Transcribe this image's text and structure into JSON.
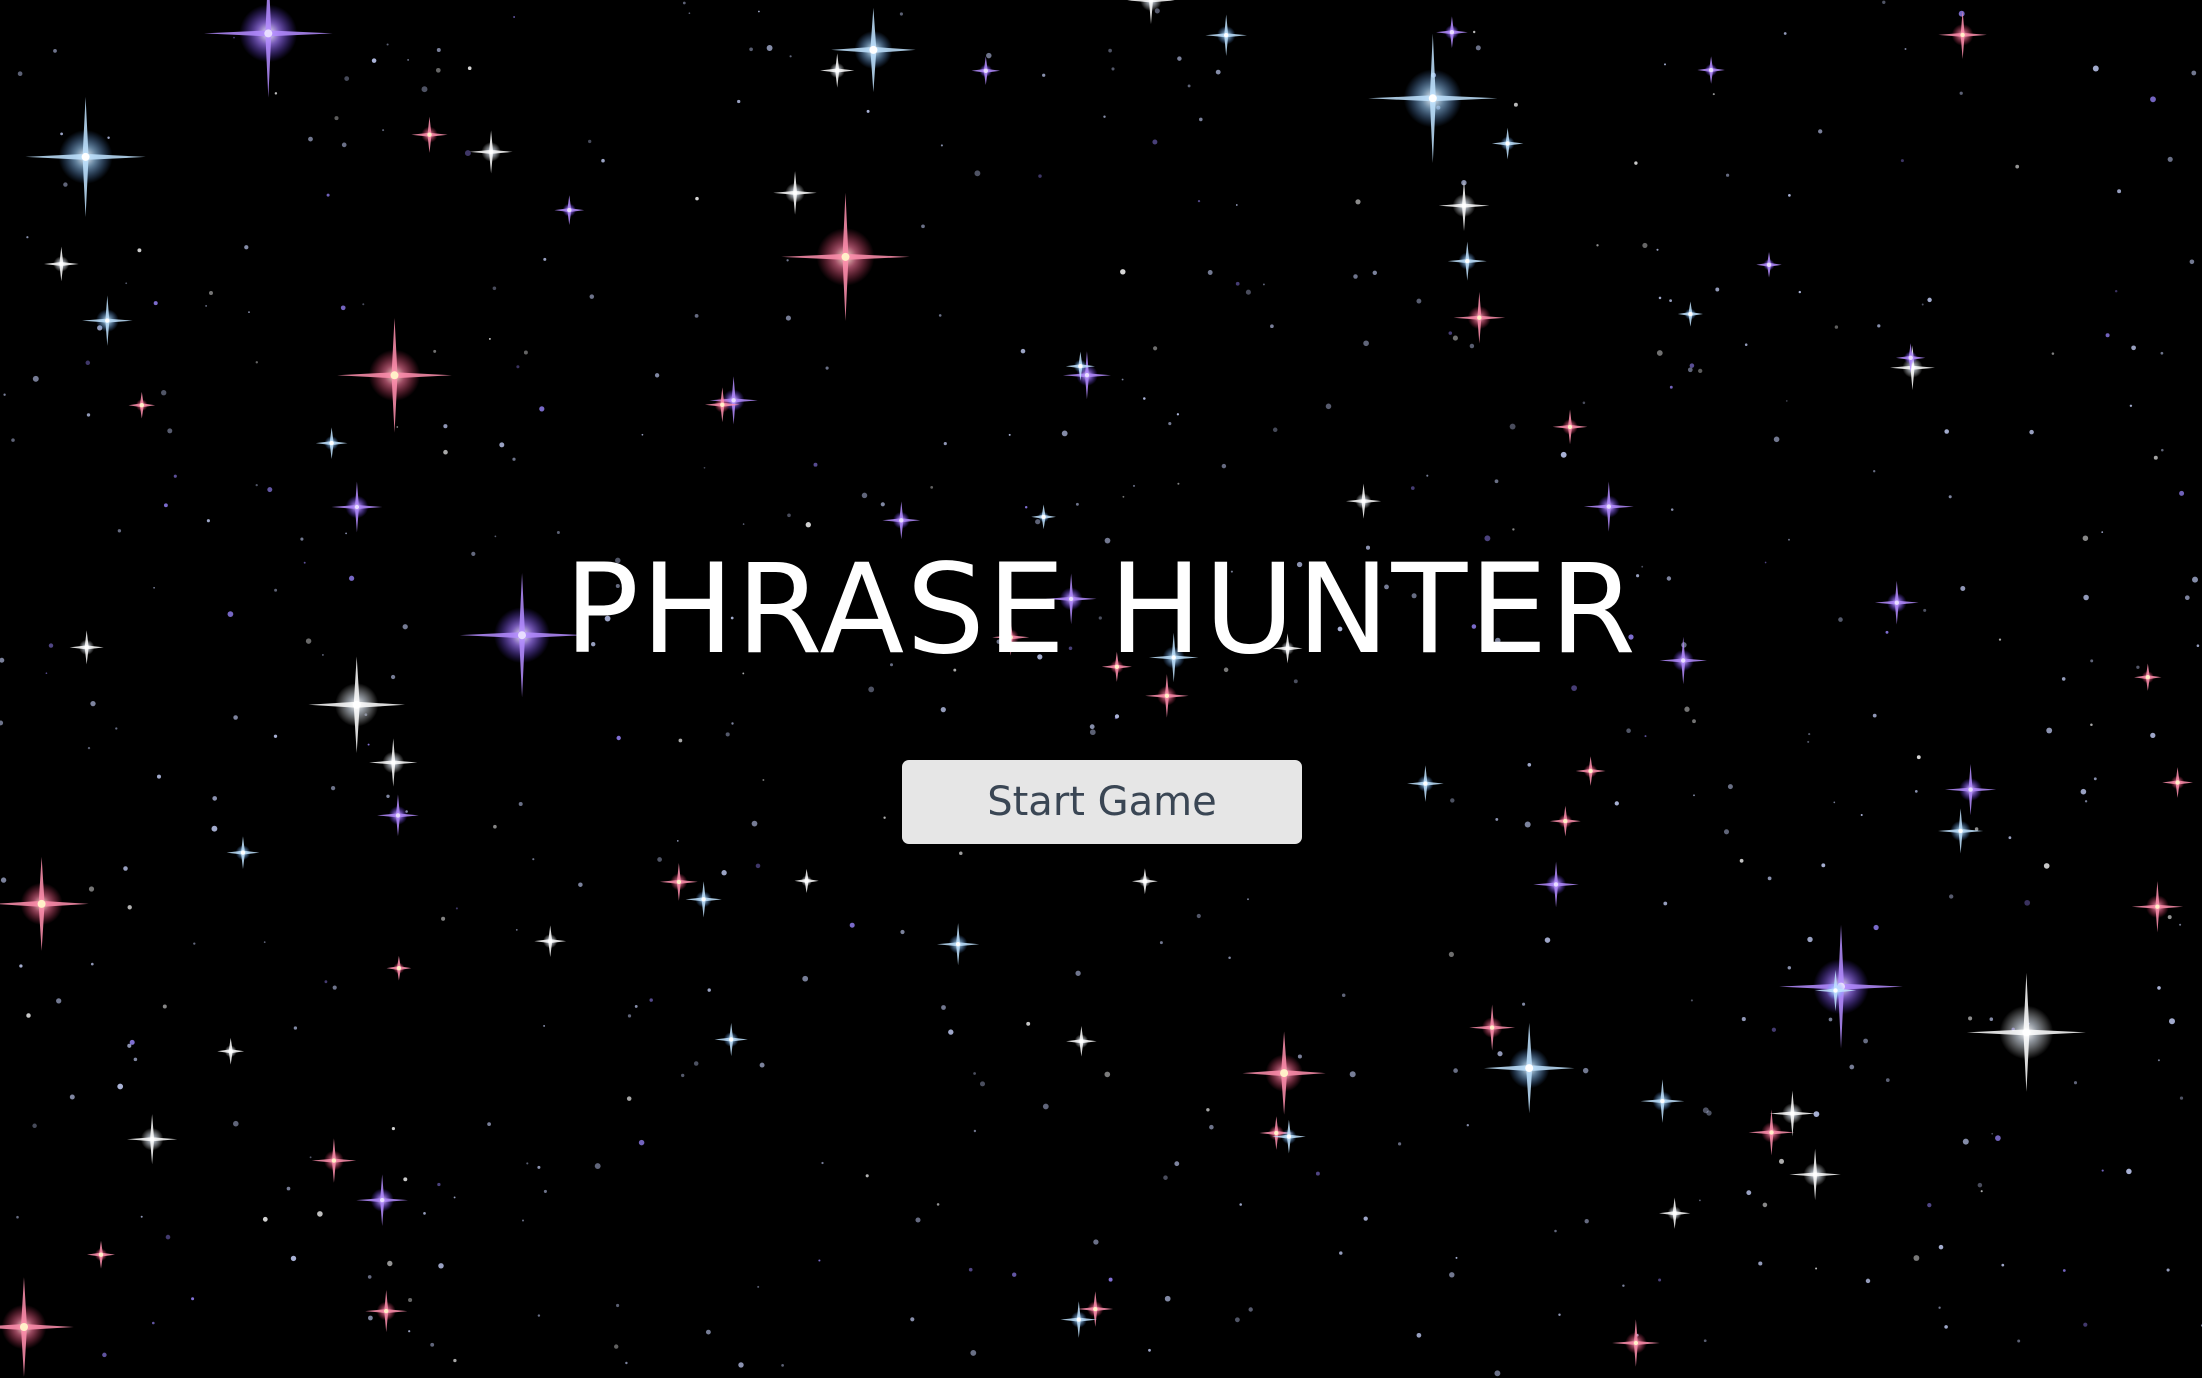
{
  "overlay": {
    "title": "PHRASE HUNTER",
    "start_button_label": "Start Game"
  },
  "colors": {
    "background": "#000000",
    "title": "#ffffff",
    "button_bg": "#e6e6e6",
    "button_text": "#3a4654",
    "star_white": "#ffffff",
    "star_blue": "#bfe3ff",
    "star_purple": "#b48cff",
    "star_pink": "#ffb4c8"
  }
}
